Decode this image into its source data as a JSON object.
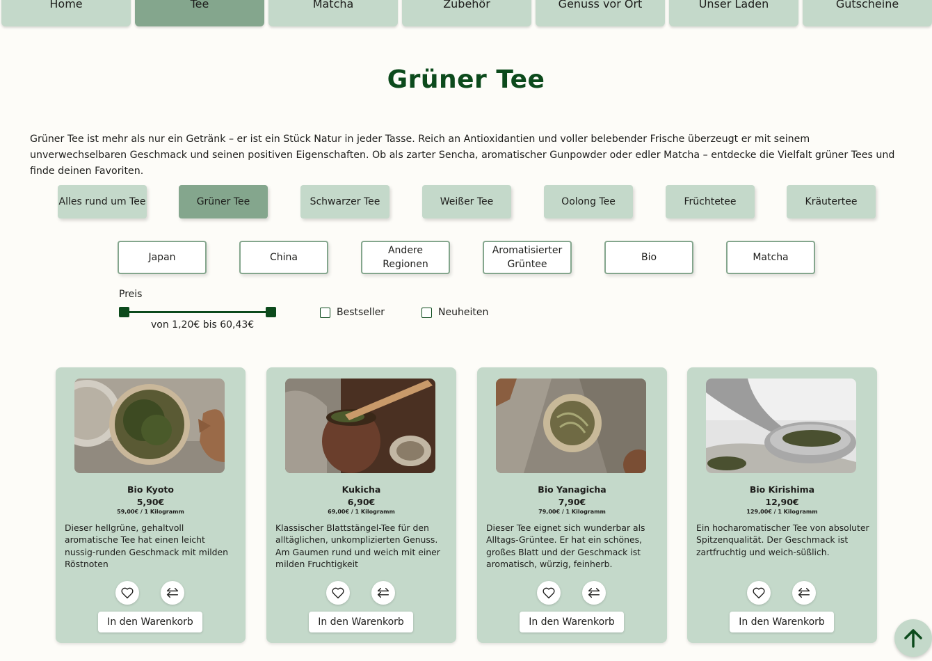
{
  "nav": {
    "items": [
      {
        "label": "Home"
      },
      {
        "label": "Tee"
      },
      {
        "label": "Matcha"
      },
      {
        "label": "Zubehör"
      },
      {
        "label": "Genuss vor Ort"
      },
      {
        "label": "Unser Laden"
      },
      {
        "label": "Gutscheine"
      }
    ],
    "active": "Tee"
  },
  "page": {
    "title": "Grüner Tee",
    "intro": "Grüner Tee ist mehr als nur ein Getränk – er ist ein Stück Natur in jeder Tasse. Reich an Antioxidantien und voller belebender Frische überzeugt er mit seinem unverwechselbaren Geschmack und seinen positiven Eigenschaften. Ob als zarter Sencha, aromatischer Gunpowder oder edler Matcha – entdecke die Vielfalt grüner Tees und finde deinen Favoriten."
  },
  "categories": {
    "items": [
      {
        "label": "Alles rund um Tee"
      },
      {
        "label": "Grüner Tee"
      },
      {
        "label": "Schwarzer Tee"
      },
      {
        "label": "Weißer Tee"
      },
      {
        "label": "Oolong Tee"
      },
      {
        "label": "Früchtetee"
      },
      {
        "label": "Kräutertee"
      }
    ],
    "active": "Grüner Tee"
  },
  "subcategories": {
    "items": [
      {
        "label": "Japan"
      },
      {
        "label": "China"
      },
      {
        "label": "Andere Regionen"
      },
      {
        "label": "Aromatisierter Grüntee"
      },
      {
        "label": "Bio"
      },
      {
        "label": "Matcha"
      }
    ]
  },
  "filters": {
    "price_label": "Preis",
    "price_range_text": "von 1,20€ bis 60,43€",
    "price_min": 1.2,
    "price_max": 60.43,
    "bestseller_label": "Bestseller",
    "bestseller_checked": false,
    "neuheiten_label": "Neuheiten",
    "neuheiten_checked": false
  },
  "products": [
    {
      "name": "Bio Kyoto",
      "price": "5,90€",
      "base_price": "59,00€ / 1 Kilogramm",
      "description": "Dieser hellgrüne, gehaltvoll aromatische Tee hat einen leicht nussig-runden Geschmack mit milden Röstnoten",
      "cart_label": "In den Warenkorb"
    },
    {
      "name": "Kukicha",
      "price": "6,90€",
      "base_price": "69,00€ / 1 Kilogramm",
      "description": "Klassischer Blattstängel-Tee für den alltäglichen, unkomplizierten Genuss. Am Gaumen rund und weich mit einer milden Fruchtigkeit",
      "cart_label": "In den Warenkorb"
    },
    {
      "name": "Bio Yanagicha",
      "price": "7,90€",
      "base_price": "79,00€ / 1 Kilogramm",
      "description": "Dieser Tee eignet sich wunderbar als Alltags-Grüntee. Er hat ein schönes, großes Blatt und der Geschmack ist aromatisch, würzig, feinherb.",
      "cart_label": "In den Warenkorb"
    },
    {
      "name": "Bio Kirishima",
      "price": "12,90€",
      "base_price": "129,00€ / 1 Kilogramm",
      "description": "Ein hocharomatischer Tee von absoluter Spitzenqualität. Der Geschmack ist zartfruchtig und weich-süßlich.",
      "cart_label": "In den Warenkorb"
    }
  ],
  "icons": {
    "wishlist": "heart-icon",
    "compare": "compare-arrows-icon",
    "scroll_top": "arrow-up-icon"
  },
  "colors": {
    "accent_dark": "#0c4a1c",
    "pill_bg": "#c4d9ca",
    "pill_active": "#84a68d",
    "page_bg": "#fdfcf8"
  }
}
